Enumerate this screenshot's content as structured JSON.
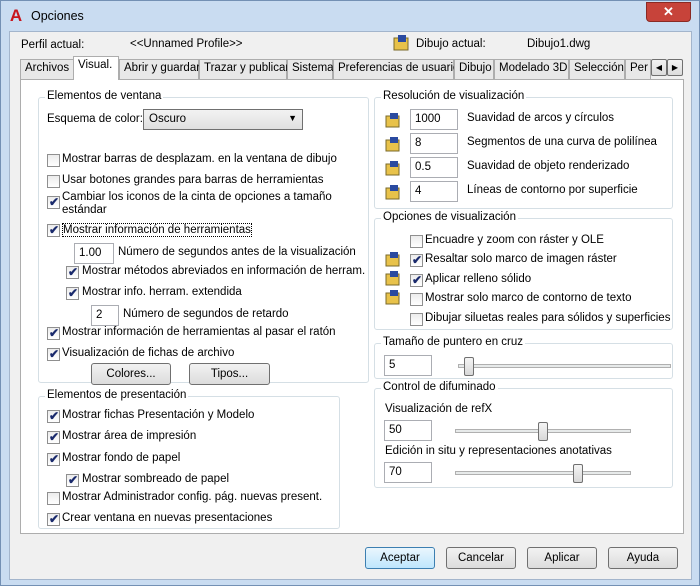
{
  "window": {
    "title": "Opciones",
    "close": "✕"
  },
  "profile": {
    "label": "Perfil actual:",
    "value": "<<Unnamed Profile>>",
    "drawing_label": "Dibujo actual:",
    "drawing_value": "Dibujo1.dwg"
  },
  "tabs": [
    "Archivos",
    "Visual.",
    "Abrir y guardar",
    "Trazar y publicar",
    "Sistema",
    "Preferencias de usuario",
    "Dibujo",
    "Modelado 3D",
    "Selección",
    "Per"
  ],
  "tab_scroll": {
    "left": "◀",
    "right": "▶"
  },
  "window_elements": {
    "title": "Elementos de ventana",
    "color_scheme_label": "Esquema de color:",
    "color_scheme_value": "Oscuro",
    "items": [
      "Mostrar barras de desplazam. en la ventana de dibujo",
      "Usar botones grandes para barras de herramientas",
      "Cambiar los iconos de la cinta de opciones a tamaño estándar",
      "Mostrar información de herramientas",
      "Número de segundos antes de la visualización",
      "Mostrar métodos abreviados en información de herram.",
      "Mostrar info. herram. extendida",
      "Número de segundos de retardo",
      "Mostrar información de herramientas al pasar el ratón",
      "Visualización de fichas de archivo"
    ],
    "tooltip_delay": "1.00",
    "extended_delay": "2",
    "colors_button": "Colores...",
    "fonts_button": "Tipos..."
  },
  "layout_elements": {
    "title": "Elementos de presentación",
    "items": [
      "Mostrar fichas Presentación y Modelo",
      "Mostrar área de impresión",
      "Mostrar fondo de papel",
      "Mostrar sombreado de papel",
      "Mostrar Administrador config. pág. nuevas present.",
      "Crear ventana en nuevas presentaciones"
    ]
  },
  "resolution": {
    "title": "Resolución de visualización",
    "rows": [
      {
        "value": "1000",
        "label": "Suavidad de arcos y círculos"
      },
      {
        "value": "8",
        "label": "Segmentos de una curva de polilínea"
      },
      {
        "value": "0.5",
        "label": "Suavidad de objeto renderizado"
      },
      {
        "value": "4",
        "label": "Líneas de contorno por superficie"
      }
    ]
  },
  "performance": {
    "title": "Opciones de visualización",
    "items": [
      "Encuadre y zoom con ráster y OLE",
      "Resaltar solo marco de imagen ráster",
      "Aplicar relleno sólido",
      "Mostrar solo marco de contorno de texto",
      "Dibujar siluetas reales para sólidos y superficies"
    ]
  },
  "crosshair": {
    "title": "Tamaño de puntero en cruz",
    "value": "5",
    "level_pct": 5
  },
  "fade": {
    "title": "Control de difuminado",
    "xref_label": "Visualización de refX",
    "xref_value": "50",
    "xref_pct": 50,
    "inplace_label": "Edición in situ y representaciones anotativas",
    "inplace_value": "70",
    "inplace_pct": 70
  },
  "buttons": {
    "ok": "Aceptar",
    "cancel": "Cancelar",
    "apply": "Aplicar",
    "help": "Ayuda"
  },
  "colors": {
    "accent": "#c8141c",
    "window_frame": "#c9dcf1"
  }
}
